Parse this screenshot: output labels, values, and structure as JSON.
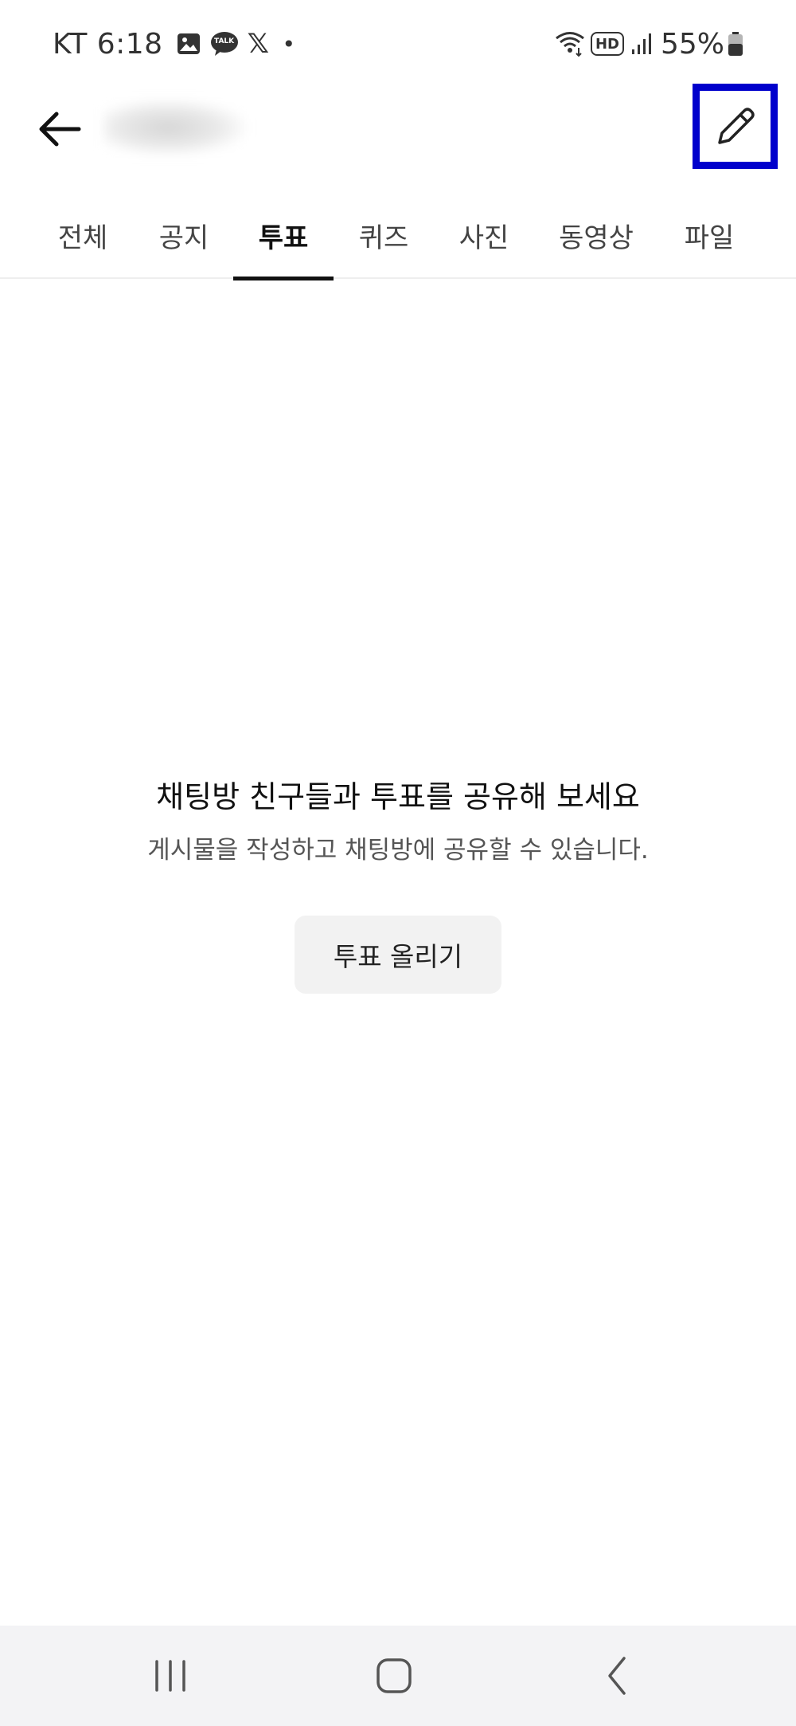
{
  "status_bar": {
    "carrier_time": "KT 6:18",
    "notification_icons": [
      "gallery-icon",
      "kakaotalk-icon",
      "x-icon",
      "dot-icon"
    ],
    "kakaotalk_badge": "TALK",
    "x_glyph": "𝕏",
    "dot": "•",
    "right_icons": [
      "wifi-icon",
      "hd-voice-icon",
      "signal-icon",
      "battery-icon"
    ],
    "hd_label": "HD",
    "battery": "55%"
  },
  "header": {
    "back_icon": "back-arrow-icon",
    "edit_icon": "pencil-icon",
    "highlight_color": "#0000cc"
  },
  "tabs": [
    {
      "label": "전체",
      "active": false
    },
    {
      "label": "공지",
      "active": false
    },
    {
      "label": "투표",
      "active": true
    },
    {
      "label": "퀴즈",
      "active": false
    },
    {
      "label": "사진",
      "active": false
    },
    {
      "label": "동영상",
      "active": false
    },
    {
      "label": "파일",
      "active": false
    }
  ],
  "empty_state": {
    "title": "채팅방 친구들과 투표를 공유해 보세요",
    "description": "게시물을 작성하고 채팅방에 공유할 수 있습니다.",
    "button_label": "투표 올리기"
  },
  "nav_bar": {
    "buttons": [
      "recent-apps-icon",
      "home-icon",
      "back-icon"
    ]
  }
}
